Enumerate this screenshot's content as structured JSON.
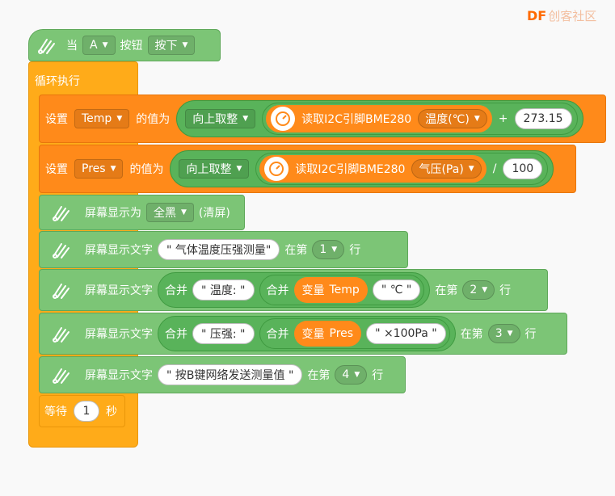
{
  "logo": {
    "brand": "DF",
    "suffix": "创客社区"
  },
  "hat": {
    "when": "当",
    "button_key": "A",
    "button_label": "按钮",
    "action": "按下"
  },
  "loop": {
    "label": "循环执行"
  },
  "set_temp": {
    "set": "设置",
    "var": "Temp",
    "value_of": "的值为",
    "round": "向上取整",
    "read": "读取I2C引脚BME280",
    "field": "温度(℃)",
    "op": "+",
    "operand": "273.15"
  },
  "set_pres": {
    "set": "设置",
    "var": "Pres",
    "value_of": "的值为",
    "round": "向上取整",
    "read": "读取I2C引脚BME280",
    "field": "气压(Pa)",
    "op": "/",
    "operand": "100"
  },
  "clear": {
    "label": "屏幕显示为",
    "mode": "全黑",
    "note": "(清屏)"
  },
  "line1": {
    "label": "屏幕显示文字",
    "text": "\"      气体温度压强测量\"",
    "at": "在第",
    "row": "1",
    "row_suffix": "行"
  },
  "line2": {
    "label": "屏幕显示文字",
    "join": "合并",
    "str1": "\" 温度: \"",
    "join2": "合并",
    "var_prefix": "变量",
    "var": "Temp",
    "str2": "\" ℃ \"",
    "at": "在第",
    "row": "2",
    "row_suffix": "行"
  },
  "line3": {
    "label": "屏幕显示文字",
    "join": "合并",
    "str1": "\" 压强: \"",
    "join2": "合并",
    "var_prefix": "变量",
    "var": "Pres",
    "str2": "\" ×100Pa \"",
    "at": "在第",
    "row": "3",
    "row_suffix": "行"
  },
  "line4": {
    "label": "屏幕显示文字",
    "text": "\" 按B键网络发送测量值 \"",
    "at": "在第",
    "row": "4",
    "row_suffix": "行"
  },
  "wait": {
    "label": "等待",
    "value": "1",
    "unit": "秒"
  },
  "icons": {
    "oled": "oled-screen-icon",
    "sensor": "gauge-sensor-icon"
  },
  "colors": {
    "display_green": "#7cc576",
    "dark_green": "#59b35a",
    "data_orange": "#ff8a1a",
    "control_yellow": "#ffab19"
  }
}
